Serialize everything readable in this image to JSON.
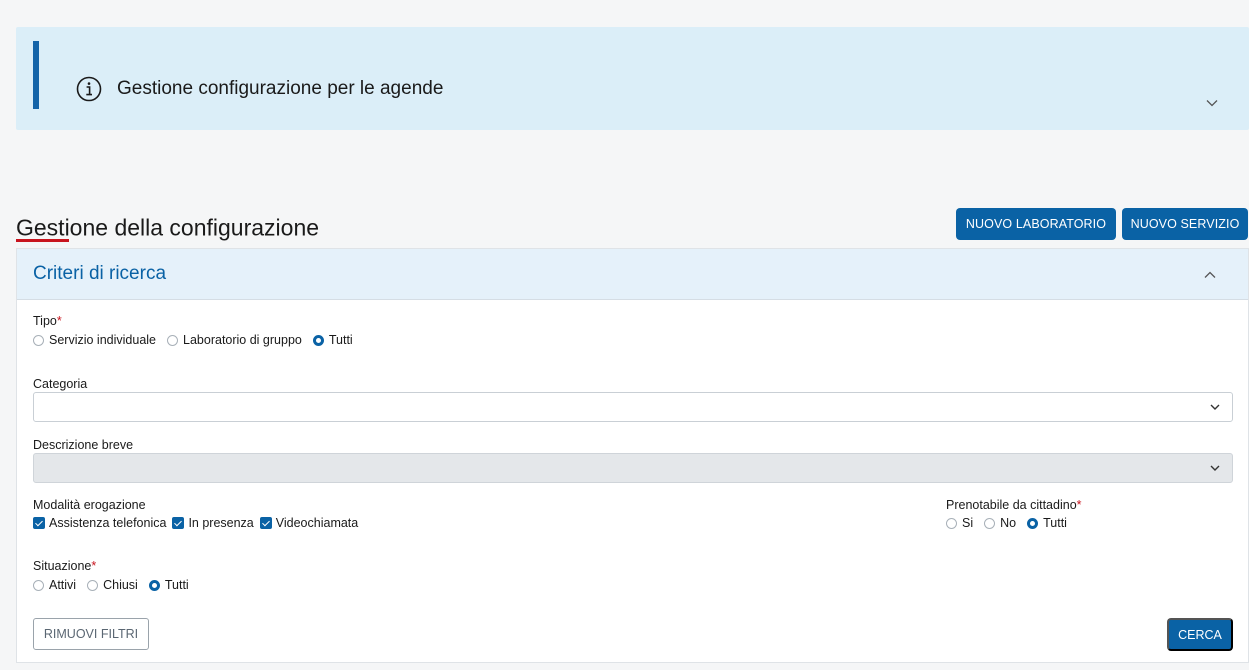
{
  "banner": {
    "title": "Gestione configurazione per le agende"
  },
  "page": {
    "title": "Gestione della configurazione",
    "btn_new_lab": "NUOVO LABORATORIO",
    "btn_new_service": "NUOVO SERVIZIO"
  },
  "search": {
    "header": "Criteri di ricerca",
    "tipo": {
      "label": "Tipo",
      "required": "*",
      "options": [
        {
          "label": "Servizio individuale",
          "selected": false
        },
        {
          "label": "Laboratorio di gruppo",
          "selected": false
        },
        {
          "label": "Tutti",
          "selected": true
        }
      ]
    },
    "categoria": {
      "label": "Categoria",
      "value": ""
    },
    "descrizione": {
      "label": "Descrizione breve",
      "value": "",
      "disabled": true
    },
    "modalita": {
      "label": "Modalità erogazione",
      "options": [
        {
          "label": "Assistenza telefonica",
          "checked": true
        },
        {
          "label": "In presenza",
          "checked": true
        },
        {
          "label": "Videochiamata",
          "checked": true
        }
      ]
    },
    "prenotabile": {
      "label": "Prenotabile da cittadino",
      "required": "*",
      "options": [
        {
          "label": "Si",
          "selected": false
        },
        {
          "label": "No",
          "selected": false
        },
        {
          "label": "Tutti",
          "selected": true
        }
      ]
    },
    "situazione": {
      "label": "Situazione",
      "required": "*",
      "options": [
        {
          "label": "Attivi",
          "selected": false
        },
        {
          "label": "Chiusi",
          "selected": false
        },
        {
          "label": "Tutti",
          "selected": true
        }
      ]
    },
    "btn_reset": "RIMUOVI FILTRI",
    "btn_search": "CERCA"
  },
  "colors": {
    "primary": "#0a62a5",
    "banner_bg": "#dbeef8",
    "required": "#c8141e"
  }
}
